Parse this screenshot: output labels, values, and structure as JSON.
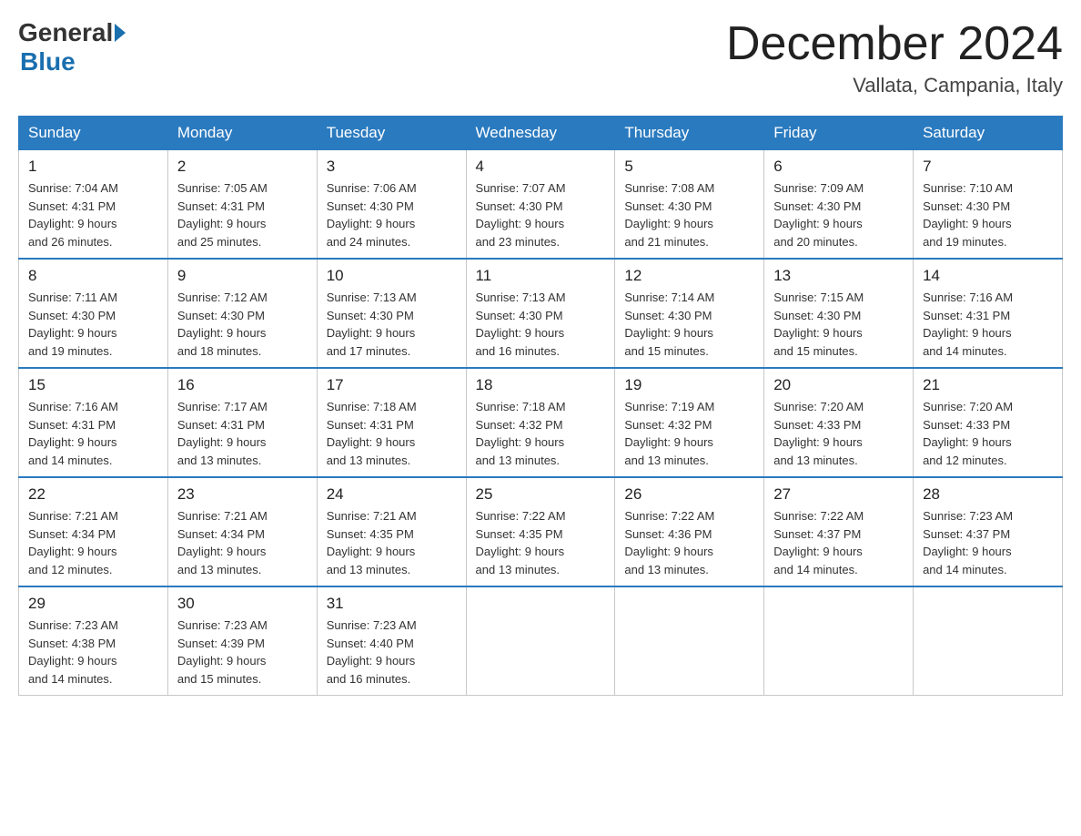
{
  "header": {
    "logo_general": "General",
    "logo_blue": "Blue",
    "month_title": "December 2024",
    "location": "Vallata, Campania, Italy"
  },
  "calendar": {
    "days_of_week": [
      "Sunday",
      "Monday",
      "Tuesday",
      "Wednesday",
      "Thursday",
      "Friday",
      "Saturday"
    ],
    "weeks": [
      [
        {
          "day": "1",
          "sunrise": "7:04 AM",
          "sunset": "4:31 PM",
          "daylight": "9 hours and 26 minutes."
        },
        {
          "day": "2",
          "sunrise": "7:05 AM",
          "sunset": "4:31 PM",
          "daylight": "9 hours and 25 minutes."
        },
        {
          "day": "3",
          "sunrise": "7:06 AM",
          "sunset": "4:30 PM",
          "daylight": "9 hours and 24 minutes."
        },
        {
          "day": "4",
          "sunrise": "7:07 AM",
          "sunset": "4:30 PM",
          "daylight": "9 hours and 23 minutes."
        },
        {
          "day": "5",
          "sunrise": "7:08 AM",
          "sunset": "4:30 PM",
          "daylight": "9 hours and 21 minutes."
        },
        {
          "day": "6",
          "sunrise": "7:09 AM",
          "sunset": "4:30 PM",
          "daylight": "9 hours and 20 minutes."
        },
        {
          "day": "7",
          "sunrise": "7:10 AM",
          "sunset": "4:30 PM",
          "daylight": "9 hours and 19 minutes."
        }
      ],
      [
        {
          "day": "8",
          "sunrise": "7:11 AM",
          "sunset": "4:30 PM",
          "daylight": "9 hours and 19 minutes."
        },
        {
          "day": "9",
          "sunrise": "7:12 AM",
          "sunset": "4:30 PM",
          "daylight": "9 hours and 18 minutes."
        },
        {
          "day": "10",
          "sunrise": "7:13 AM",
          "sunset": "4:30 PM",
          "daylight": "9 hours and 17 minutes."
        },
        {
          "day": "11",
          "sunrise": "7:13 AM",
          "sunset": "4:30 PM",
          "daylight": "9 hours and 16 minutes."
        },
        {
          "day": "12",
          "sunrise": "7:14 AM",
          "sunset": "4:30 PM",
          "daylight": "9 hours and 15 minutes."
        },
        {
          "day": "13",
          "sunrise": "7:15 AM",
          "sunset": "4:30 PM",
          "daylight": "9 hours and 15 minutes."
        },
        {
          "day": "14",
          "sunrise": "7:16 AM",
          "sunset": "4:31 PM",
          "daylight": "9 hours and 14 minutes."
        }
      ],
      [
        {
          "day": "15",
          "sunrise": "7:16 AM",
          "sunset": "4:31 PM",
          "daylight": "9 hours and 14 minutes."
        },
        {
          "day": "16",
          "sunrise": "7:17 AM",
          "sunset": "4:31 PM",
          "daylight": "9 hours and 13 minutes."
        },
        {
          "day": "17",
          "sunrise": "7:18 AM",
          "sunset": "4:31 PM",
          "daylight": "9 hours and 13 minutes."
        },
        {
          "day": "18",
          "sunrise": "7:18 AM",
          "sunset": "4:32 PM",
          "daylight": "9 hours and 13 minutes."
        },
        {
          "day": "19",
          "sunrise": "7:19 AM",
          "sunset": "4:32 PM",
          "daylight": "9 hours and 13 minutes."
        },
        {
          "day": "20",
          "sunrise": "7:20 AM",
          "sunset": "4:33 PM",
          "daylight": "9 hours and 13 minutes."
        },
        {
          "day": "21",
          "sunrise": "7:20 AM",
          "sunset": "4:33 PM",
          "daylight": "9 hours and 12 minutes."
        }
      ],
      [
        {
          "day": "22",
          "sunrise": "7:21 AM",
          "sunset": "4:34 PM",
          "daylight": "9 hours and 12 minutes."
        },
        {
          "day": "23",
          "sunrise": "7:21 AM",
          "sunset": "4:34 PM",
          "daylight": "9 hours and 13 minutes."
        },
        {
          "day": "24",
          "sunrise": "7:21 AM",
          "sunset": "4:35 PM",
          "daylight": "9 hours and 13 minutes."
        },
        {
          "day": "25",
          "sunrise": "7:22 AM",
          "sunset": "4:35 PM",
          "daylight": "9 hours and 13 minutes."
        },
        {
          "day": "26",
          "sunrise": "7:22 AM",
          "sunset": "4:36 PM",
          "daylight": "9 hours and 13 minutes."
        },
        {
          "day": "27",
          "sunrise": "7:22 AM",
          "sunset": "4:37 PM",
          "daylight": "9 hours and 14 minutes."
        },
        {
          "day": "28",
          "sunrise": "7:23 AM",
          "sunset": "4:37 PM",
          "daylight": "9 hours and 14 minutes."
        }
      ],
      [
        {
          "day": "29",
          "sunrise": "7:23 AM",
          "sunset": "4:38 PM",
          "daylight": "9 hours and 14 minutes."
        },
        {
          "day": "30",
          "sunrise": "7:23 AM",
          "sunset": "4:39 PM",
          "daylight": "9 hours and 15 minutes."
        },
        {
          "day": "31",
          "sunrise": "7:23 AM",
          "sunset": "4:40 PM",
          "daylight": "9 hours and 16 minutes."
        },
        null,
        null,
        null,
        null
      ]
    ]
  }
}
